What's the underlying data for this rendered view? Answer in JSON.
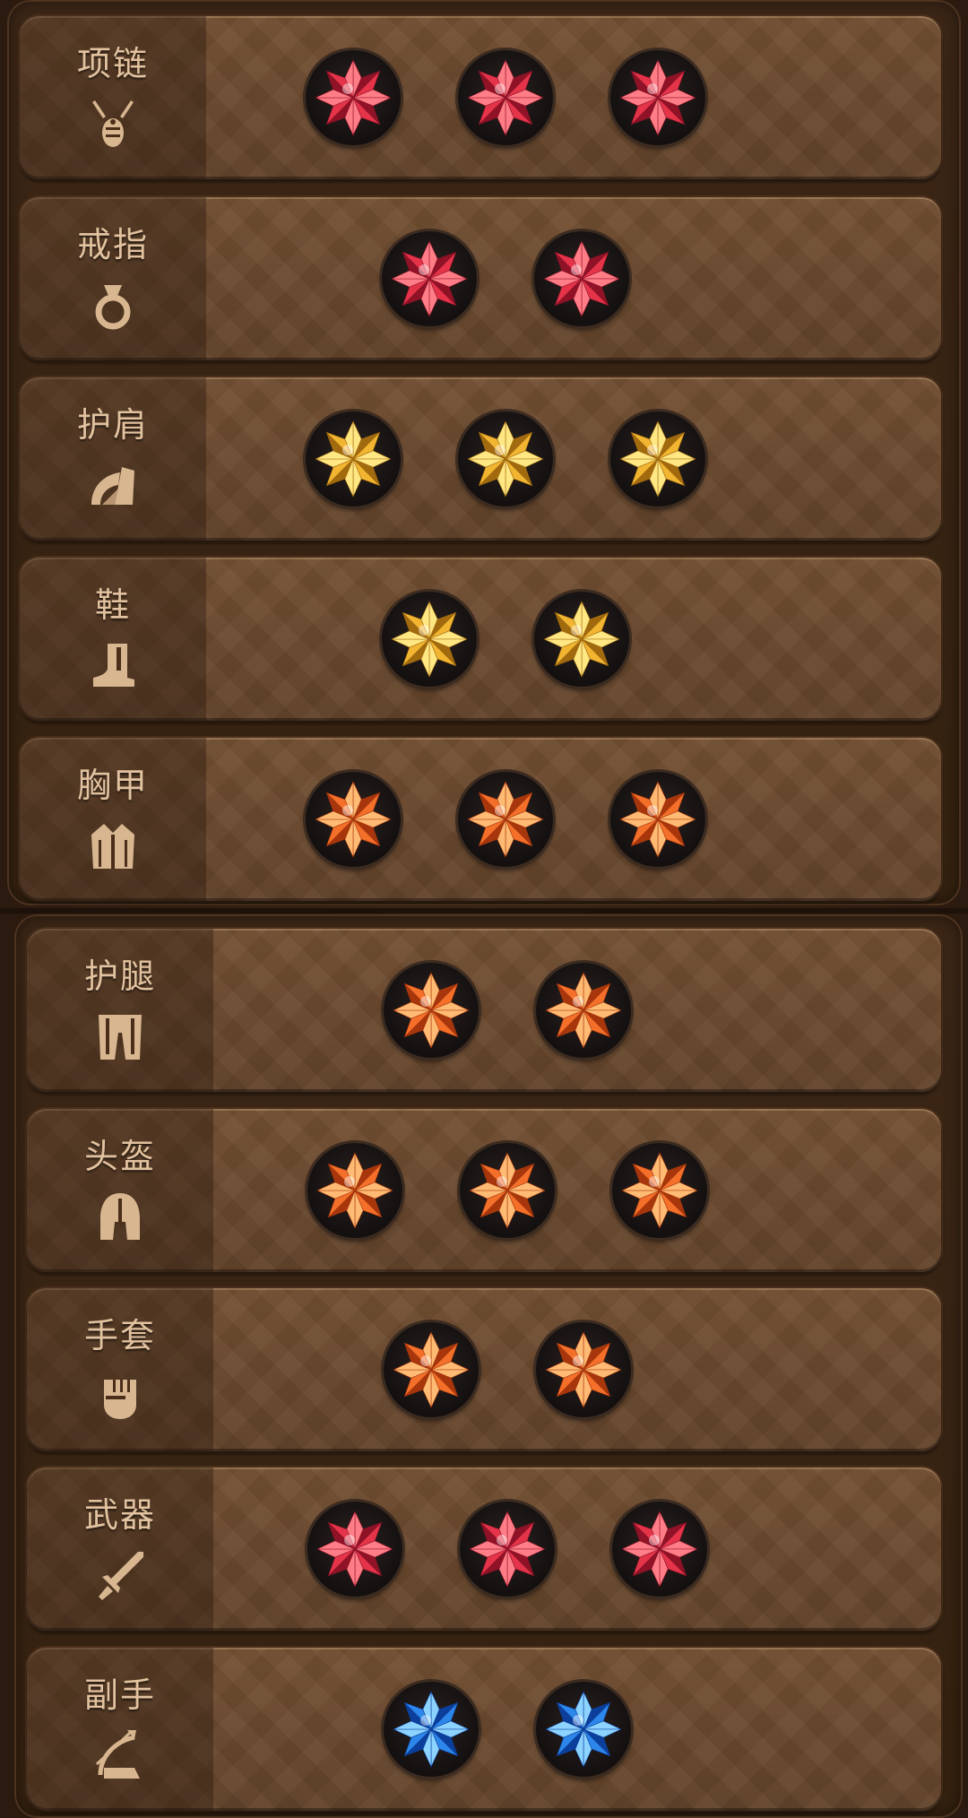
{
  "rows": [
    {
      "label": "项链",
      "icon": "necklace-icon",
      "gems": [
        "red",
        "red",
        "red"
      ]
    },
    {
      "label": "戒指",
      "icon": "ring-icon",
      "gems": [
        "red",
        "red"
      ]
    },
    {
      "label": "护肩",
      "icon": "shoulder-armor-icon",
      "gems": [
        "gold",
        "gold",
        "gold"
      ]
    },
    {
      "label": "鞋",
      "icon": "boot-icon",
      "gems": [
        "gold",
        "gold"
      ]
    },
    {
      "label": "胸甲",
      "icon": "chest-armor-icon",
      "gems": [
        "orange",
        "orange",
        "orange"
      ]
    },
    {
      "label": "护腿",
      "icon": "leg-armor-icon",
      "gems": [
        "orange",
        "orange"
      ]
    },
    {
      "label": "头盔",
      "icon": "helmet-icon",
      "gems": [
        "orange",
        "orange",
        "orange"
      ]
    },
    {
      "label": "手套",
      "icon": "gauntlet-icon",
      "gems": [
        "orange",
        "orange"
      ]
    },
    {
      "label": "武器",
      "icon": "sword-icon",
      "gems": [
        "red",
        "red",
        "red"
      ]
    },
    {
      "label": "副手",
      "icon": "bow-icon",
      "gems": [
        "blue",
        "blue"
      ]
    }
  ],
  "gem_colors": {
    "red": {
      "light": "#ff7d86",
      "mid": "#e5344a",
      "dark": "#8f1227"
    },
    "gold": {
      "light": "#ffe783",
      "mid": "#f2b531",
      "dark": "#a26a0e"
    },
    "orange": {
      "light": "#ffbb73",
      "mid": "#f4702a",
      "dark": "#a8360c"
    },
    "blue": {
      "light": "#8dd3ff",
      "mid": "#2d86ea",
      "dark": "#0c3f9c"
    }
  }
}
